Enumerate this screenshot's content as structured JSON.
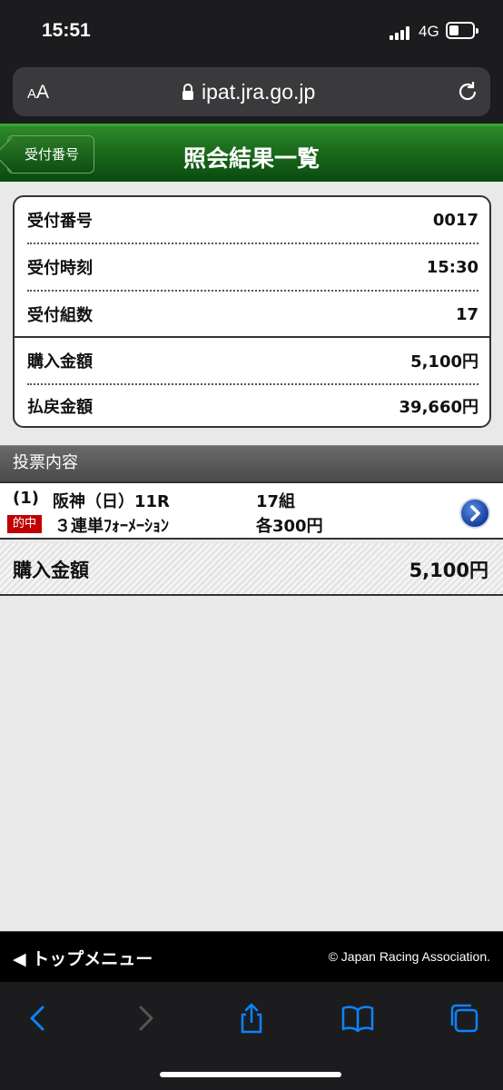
{
  "status_bar": {
    "time": "15:51",
    "network": "4G"
  },
  "browser": {
    "aa_small": "A",
    "aa_big": "A",
    "url": "ipat.jra.go.jp"
  },
  "header": {
    "back_label": "受付番号",
    "title": "照会結果一覧"
  },
  "summary": {
    "rows": [
      {
        "label": "受付番号",
        "value": "0017"
      },
      {
        "label": "受付時刻",
        "value": "15:30"
      },
      {
        "label": "受付組数",
        "value": "17"
      },
      {
        "label": "購入金額",
        "value": "5,100円"
      },
      {
        "label": "払戻金額",
        "value": "39,660円"
      }
    ]
  },
  "section_title": "投票内容",
  "bet": {
    "index": "(1)",
    "race": "阪神（日）11R",
    "combos": "17組",
    "badge": "的中",
    "bet_type": "３連単ﾌｫｰﾒｰｼｮﾝ",
    "unit": "各300円"
  },
  "total": {
    "label": "購入金額",
    "value": "5,100円"
  },
  "footer": {
    "menu_label": "トップメニュー",
    "copyright": "© Japan Racing Association."
  },
  "colors": {
    "header_green": "#1a6b1c",
    "badge_red": "#c00000",
    "ios_blue": "#0a84ff"
  }
}
